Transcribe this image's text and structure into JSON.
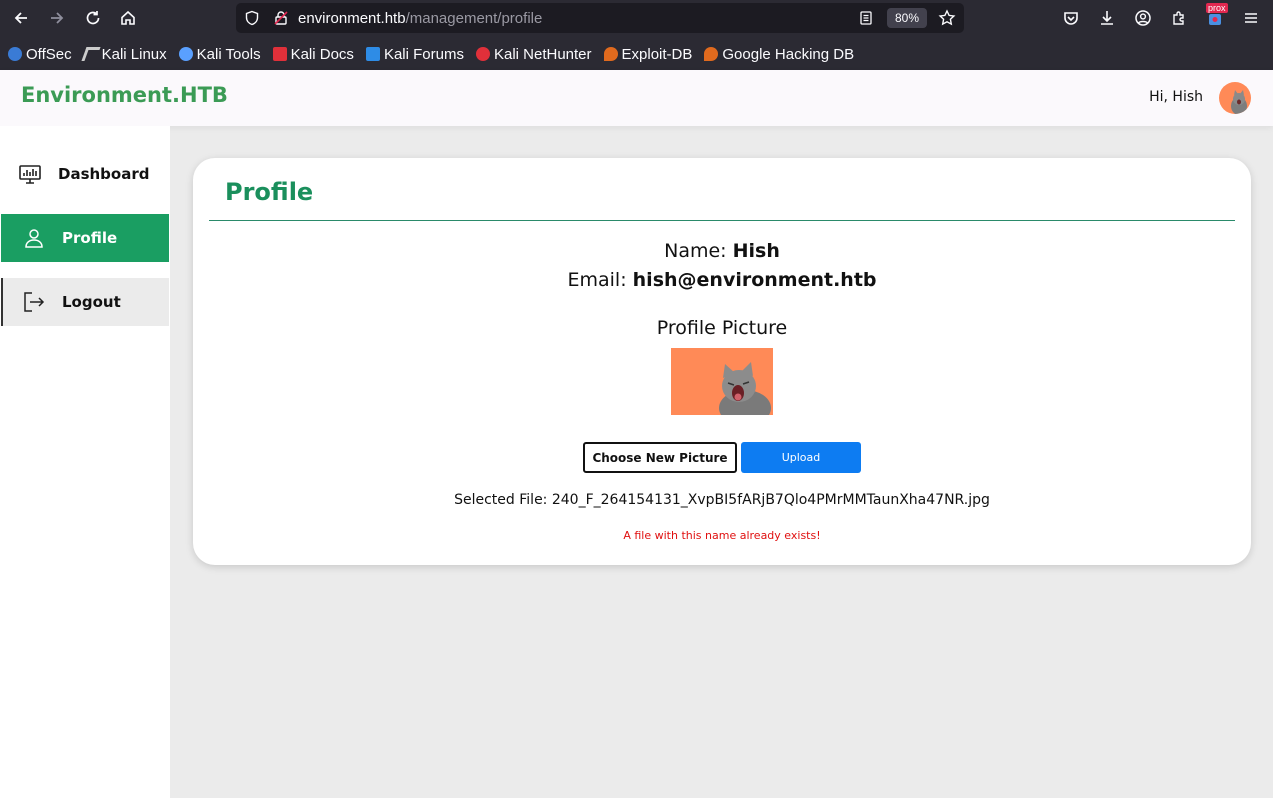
{
  "browser": {
    "url_host": "environment.htb",
    "url_path": "/management/profile",
    "zoom": "80%",
    "bookmarks": [
      {
        "label": "OffSec",
        "icon": "offsec-icon",
        "color": "#3a7bd5"
      },
      {
        "label": "Kali Linux",
        "icon": "kali-dragon-icon",
        "color": "#cccccc"
      },
      {
        "label": "Kali Tools",
        "icon": "kali-tools-icon",
        "color": "#5aa0ff"
      },
      {
        "label": "Kali Docs",
        "icon": "kali-docs-icon",
        "color": "#e0303a"
      },
      {
        "label": "Kali Forums",
        "icon": "kali-forums-icon",
        "color": "#2e8ce6"
      },
      {
        "label": "Kali NetHunter",
        "icon": "nethunter-icon",
        "color": "#e0303a"
      },
      {
        "label": "Exploit-DB",
        "icon": "exploit-db-icon",
        "color": "#e06a1e"
      },
      {
        "label": "Google Hacking DB",
        "icon": "ghdb-icon",
        "color": "#e06a1e"
      }
    ],
    "extension_badge": "prox"
  },
  "header": {
    "brand": "Environment.HTB",
    "greeting": "Hi, Hish"
  },
  "sidebar": {
    "items": [
      {
        "label": "Dashboard",
        "icon": "dashboard-monitor-icon",
        "active": false
      },
      {
        "label": "Profile",
        "icon": "user-icon",
        "active": true
      },
      {
        "label": "Logout",
        "icon": "logout-icon",
        "active": false
      }
    ]
  },
  "profile": {
    "title": "Profile",
    "name_label": "Name:",
    "name_value": "Hish",
    "email_label": "Email:",
    "email_value": "hish@environment.htb",
    "picture_heading": "Profile Picture",
    "choose_button": "Choose New Picture",
    "upload_button": "Upload",
    "selected_file_label": "Selected File:",
    "selected_file_value": "240_F_264154131_XvpBI5fARjB7Qlo4PMrMMTaunXha47NR.jpg",
    "error_message": "A file with this name already exists!"
  },
  "colors": {
    "accent_green": "#1a9e62",
    "brand_green": "#3b9b55",
    "upload_blue": "#0d7cf2",
    "error_red": "#e01010",
    "avatar_bg": "#ff8a57"
  }
}
